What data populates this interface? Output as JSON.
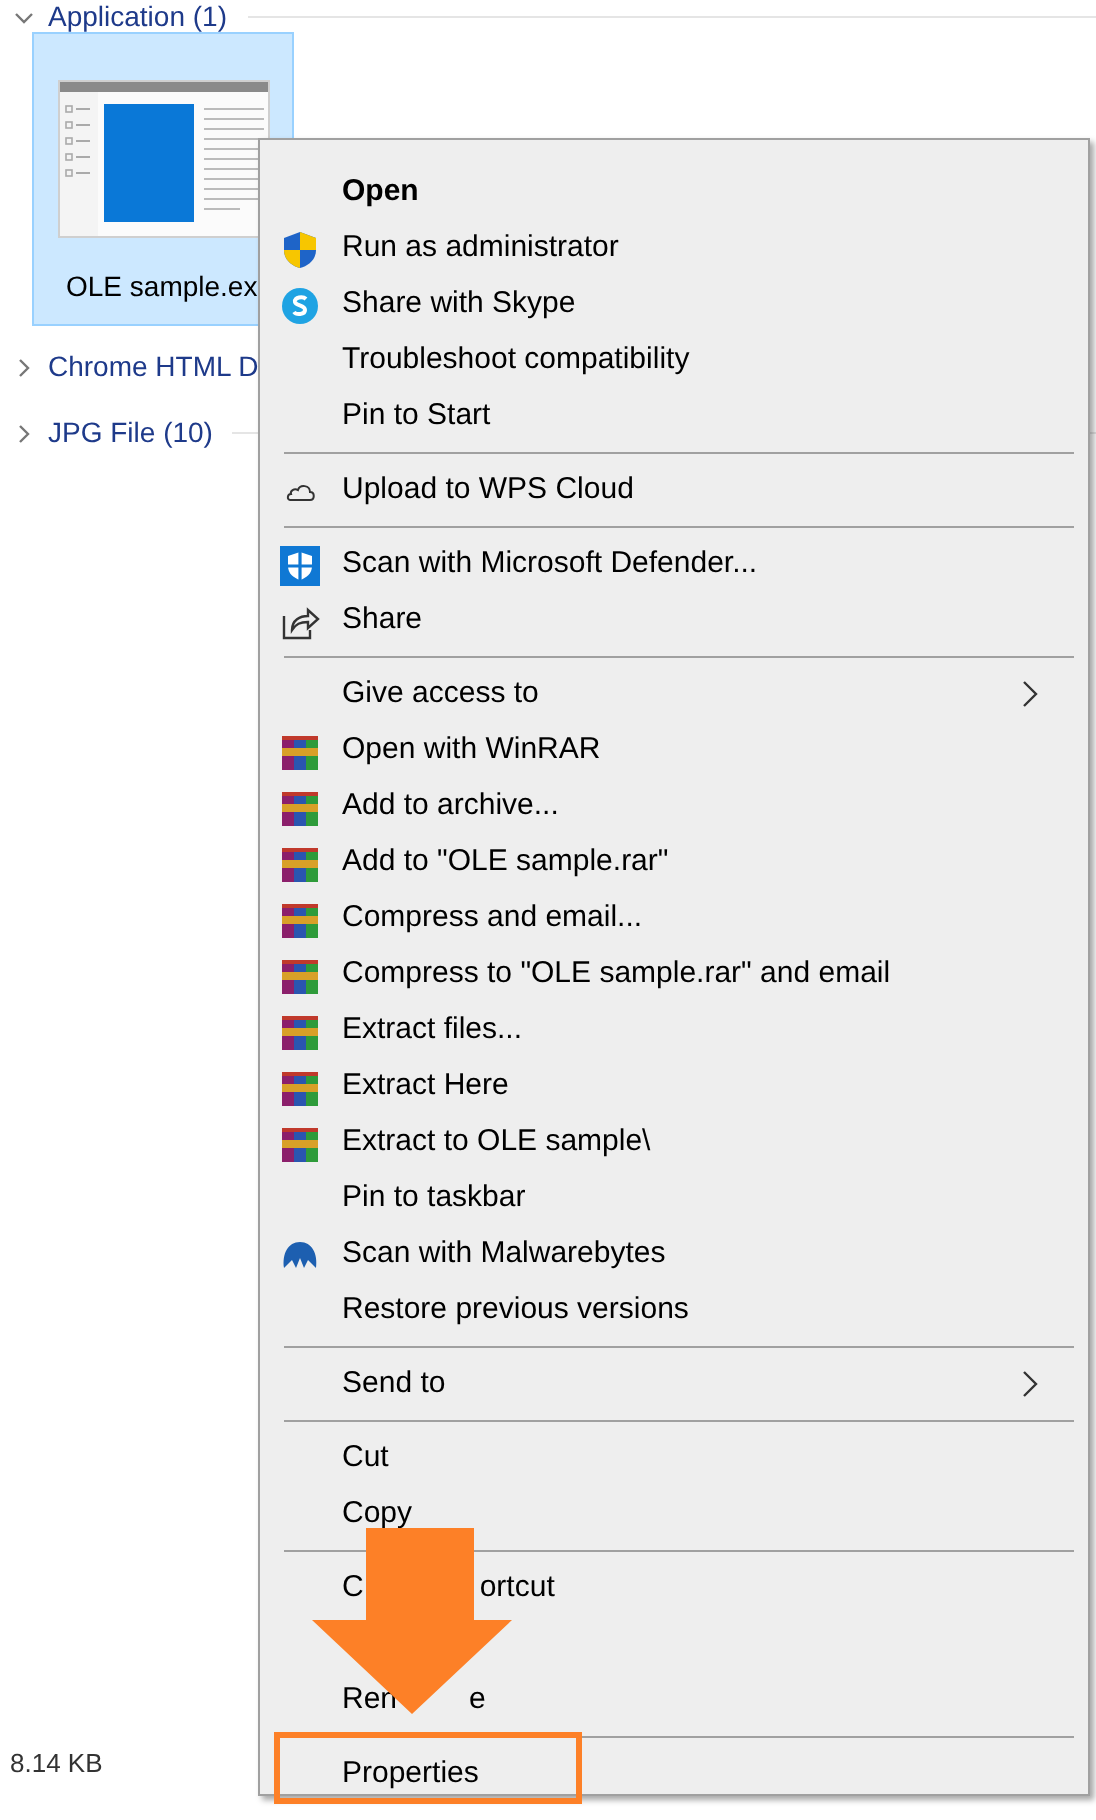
{
  "groups": [
    {
      "label": "Application (1)",
      "expanded": true
    },
    {
      "label": "Chrome HTML D",
      "expanded": false
    },
    {
      "label": "JPG File (10)",
      "expanded": false
    }
  ],
  "file": {
    "name": "OLE sample.ex",
    "selected": true
  },
  "status_bar": {
    "size": "8.14 KB"
  },
  "menu": {
    "entries": [
      {
        "kind": "item",
        "label": "Open",
        "default": true,
        "submenu": false,
        "highlighted": false
      },
      {
        "kind": "item",
        "label": "Run as administrator",
        "default": false,
        "submenu": false,
        "highlighted": false
      },
      {
        "kind": "item",
        "label": "Share with Skype",
        "default": false,
        "submenu": false,
        "highlighted": false
      },
      {
        "kind": "item",
        "label": "Troubleshoot compatibility",
        "default": false,
        "submenu": false,
        "highlighted": false
      },
      {
        "kind": "item",
        "label": "Pin to Start",
        "default": false,
        "submenu": false,
        "highlighted": false
      },
      {
        "kind": "separator"
      },
      {
        "kind": "item",
        "label": "Upload to WPS Cloud",
        "default": false,
        "submenu": false,
        "highlighted": false
      },
      {
        "kind": "separator"
      },
      {
        "kind": "item",
        "label": "Scan with Microsoft Defender...",
        "default": false,
        "submenu": false,
        "highlighted": false
      },
      {
        "kind": "item",
        "label": "Share",
        "default": false,
        "submenu": false,
        "highlighted": false
      },
      {
        "kind": "separator"
      },
      {
        "kind": "item",
        "label": "Give access to",
        "default": false,
        "submenu": true,
        "highlighted": false
      },
      {
        "kind": "item",
        "label": "Open with WinRAR",
        "default": false,
        "submenu": false,
        "highlighted": false
      },
      {
        "kind": "item",
        "label": "Add to archive...",
        "default": false,
        "submenu": false,
        "highlighted": false
      },
      {
        "kind": "item",
        "label": "Add to \"OLE sample.rar\"",
        "default": false,
        "submenu": false,
        "highlighted": false
      },
      {
        "kind": "item",
        "label": "Compress and email...",
        "default": false,
        "submenu": false,
        "highlighted": false
      },
      {
        "kind": "item",
        "label": "Compress to \"OLE sample.rar\" and email",
        "default": false,
        "submenu": false,
        "highlighted": false
      },
      {
        "kind": "item",
        "label": "Extract files...",
        "default": false,
        "submenu": false,
        "highlighted": false
      },
      {
        "kind": "item",
        "label": "Extract Here",
        "default": false,
        "submenu": false,
        "highlighted": false
      },
      {
        "kind": "item",
        "label": "Extract to OLE sample\\",
        "default": false,
        "submenu": false,
        "highlighted": false
      },
      {
        "kind": "item",
        "label": "Pin to taskbar",
        "default": false,
        "submenu": false,
        "highlighted": false
      },
      {
        "kind": "item",
        "label": "Scan with Malwarebytes",
        "default": false,
        "submenu": false,
        "highlighted": false
      },
      {
        "kind": "item",
        "label": "Restore previous versions",
        "default": false,
        "submenu": false,
        "highlighted": false
      },
      {
        "kind": "separator"
      },
      {
        "kind": "item",
        "label": "Send to",
        "default": false,
        "submenu": true,
        "highlighted": false
      },
      {
        "kind": "separator"
      },
      {
        "kind": "item",
        "label": "Cut",
        "default": false,
        "submenu": false,
        "highlighted": false
      },
      {
        "kind": "item",
        "label": "Copy",
        "default": false,
        "submenu": false,
        "highlighted": false
      },
      {
        "kind": "separator"
      },
      {
        "kind": "item",
        "label_parts": [
          "C",
          "ortcut"
        ],
        "default": false,
        "submenu": false,
        "highlighted": false
      },
      {
        "kind": "covered"
      },
      {
        "kind": "item",
        "label_parts": [
          "Ren",
          "e"
        ],
        "default": false,
        "submenu": false,
        "highlighted": false
      },
      {
        "kind": "separator"
      },
      {
        "kind": "item",
        "label": "Properties",
        "default": false,
        "submenu": false,
        "highlighted": true
      }
    ]
  }
}
